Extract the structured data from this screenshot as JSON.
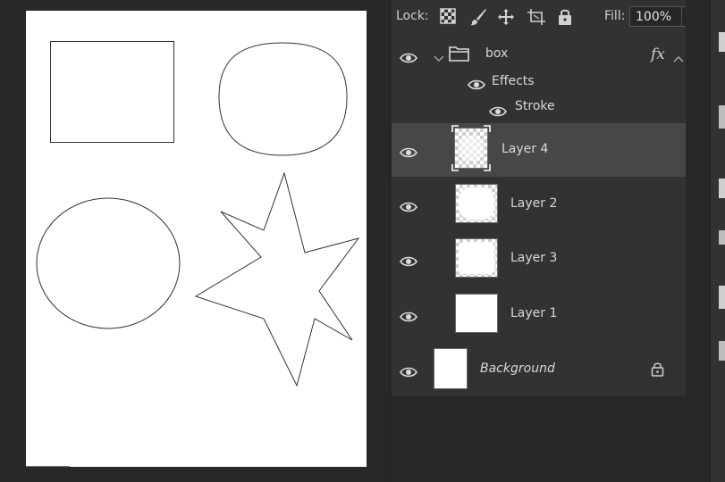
{
  "lock_bar": {
    "lock_label": "Lock:",
    "lock_icons": [
      "transparency-lock-icon",
      "brush-lock-icon",
      "move-lock-icon",
      "artboard-lock-icon",
      "padlock-icon"
    ],
    "fill_label": "Fill:",
    "fill_value": "100%"
  },
  "layers": {
    "group": {
      "name": "box",
      "fx_label": "fx",
      "effects_label": "Effects",
      "stroke_label": "Stroke"
    },
    "items": [
      {
        "name": "Layer 4",
        "selected": true
      },
      {
        "name": "Layer 2"
      },
      {
        "name": "Layer 3"
      },
      {
        "name": "Layer 1"
      }
    ],
    "background": {
      "name": "Background",
      "locked": true
    }
  },
  "colors": {
    "panel_bg": "#323232",
    "selected_row": "#474747",
    "workspace_bg": "#282828",
    "document_bg": "#ffffff"
  }
}
